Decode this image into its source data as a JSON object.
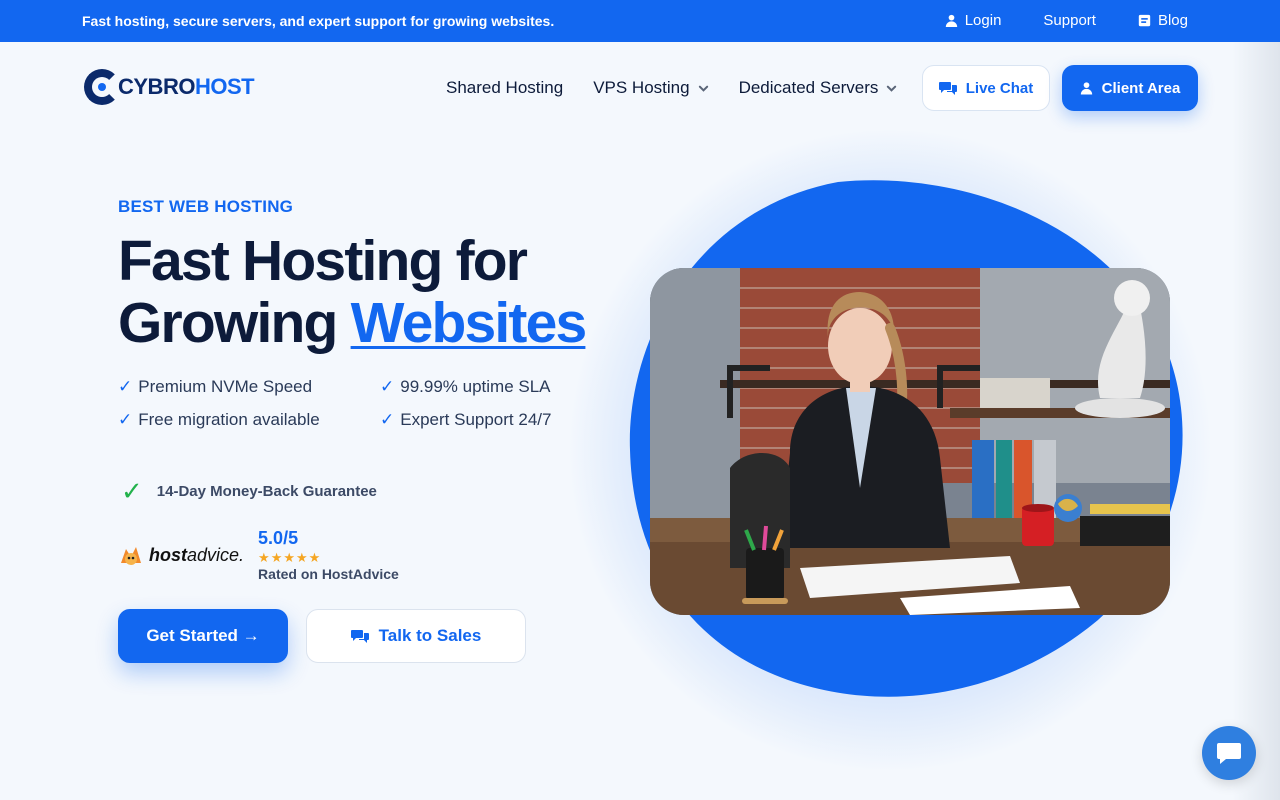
{
  "topbar": {
    "tagline": "Fast hosting, secure servers, and expert support for growing websites.",
    "links": {
      "login": "Login",
      "support": "Support",
      "blog": "Blog"
    }
  },
  "header": {
    "logo": {
      "part1": "CYBRO",
      "part2": "HOST"
    },
    "nav": {
      "shared": "Shared Hosting",
      "vps": "VPS Hosting",
      "dedicated": "Dedicated Servers"
    },
    "live_chat": "Live Chat",
    "client_area": "Client Area"
  },
  "hero": {
    "eyebrow": "BEST WEB HOSTING",
    "title_line1": "Fast Hosting for",
    "title_line2": "Growing",
    "title_highlight": "Websites",
    "features": [
      {
        "check": "✓",
        "label": "Premium NVMe Speed"
      },
      {
        "check": "✓",
        "label": "99.99% uptime SLA"
      },
      {
        "check": "✓",
        "label": "Free migration available"
      },
      {
        "check": "✓",
        "label": "Expert Support 24/7"
      }
    ],
    "guarantee": {
      "check": "✓",
      "label": "14-Day Money-Back Guarantee"
    },
    "rating": {
      "brand_bold": "host",
      "brand_rest": "advice.",
      "score": "5.0/5",
      "stars": "★★★★★",
      "caption": "Rated on HostAdvice"
    },
    "cta_primary": "Get Started →",
    "cta_secondary": "Talk to Sales"
  },
  "colors": {
    "brand": "#1267f0",
    "navy": "#0b2a6b",
    "check_green": "#22b24c",
    "star": "#f5a623"
  },
  "icons": {
    "login": "user-icon",
    "blog": "blog-icon",
    "chat": "chat-bubbles-icon",
    "client": "user-icon",
    "widget": "chat-widget-icon"
  }
}
